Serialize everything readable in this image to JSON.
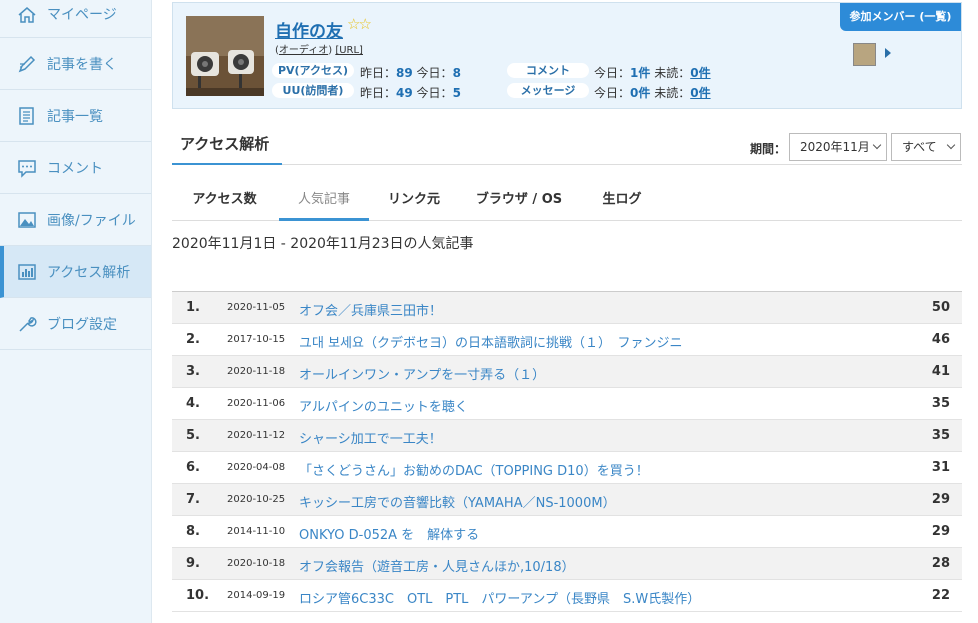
{
  "sidebar": {
    "items": [
      {
        "label": "マイページ",
        "icon": "home-icon"
      },
      {
        "label": "記事を書く",
        "icon": "pencil-icon"
      },
      {
        "label": "記事一覧",
        "icon": "document-list-icon"
      },
      {
        "label": "コメント",
        "icon": "comment-icon"
      },
      {
        "label": "画像/ファイル",
        "icon": "image-icon"
      },
      {
        "label": "アクセス解析",
        "icon": "bar-chart-icon"
      },
      {
        "label": "ブログ設定",
        "icon": "wrench-icon"
      }
    ]
  },
  "blog": {
    "title": "自作の友",
    "stars": "☆☆",
    "category_prefix": "(",
    "category": "オーディオ",
    "category_suffix": ")",
    "url_label": "[URL]",
    "pv_label": "PV(アクセス)",
    "uu_label": "UU(訪問者)",
    "comment_label": "コメント",
    "message_label": "メッセージ",
    "yesterday": "昨日：",
    "today": "今日：",
    "unread": "未読：",
    "pv_yesterday": "89",
    "pv_today": "8",
    "uu_yesterday": "49",
    "uu_today": "5",
    "comment_today": "1件",
    "comment_unread": "0件",
    "message_today": "0件",
    "message_unread": "0件",
    "member_button": "参加メンバー (一覧)"
  },
  "analytics": {
    "title": "アクセス解析",
    "period_label": "期間：",
    "period_value": "2020年11月",
    "filter_value": "すべて",
    "tabs": [
      "アクセス数",
      "人気記事",
      "リンク元",
      "ブラウザ / OS",
      "生ログ"
    ],
    "active_tab": "人気記事",
    "range_text": "2020年11月1日 - 2020年11月23日の人気記事"
  },
  "articles": [
    {
      "rank": "1.",
      "date": "2020-11-05",
      "title": "オフ会／兵庫県三田市！",
      "count": "50"
    },
    {
      "rank": "2.",
      "date": "2017-10-15",
      "title": "ユ대 보세요（クデボセヨ）の日本語歌詞に挑戦（１）　ファンジニ",
      "count": "46"
    },
    {
      "rank": "3.",
      "date": "2020-11-18",
      "title": "オールインワン・アンプを一寸弄る（１）",
      "count": "41"
    },
    {
      "rank": "4.",
      "date": "2020-11-06",
      "title": "アルパインのユニットを聴く",
      "count": "35"
    },
    {
      "rank": "5.",
      "date": "2020-11-12",
      "title": "シャーシ加工で一工夫！",
      "count": "35"
    },
    {
      "rank": "6.",
      "date": "2020-04-08",
      "title": "「さくどうさん」お勧めのDAC（TOPPING D10）を買う！",
      "count": "31"
    },
    {
      "rank": "7.",
      "date": "2020-10-25",
      "title": "キッシー工房での音響比較（YAMAHA／NS-1000M）",
      "count": "29"
    },
    {
      "rank": "8.",
      "date": "2014-11-10",
      "title": "ONKYO D-052A を　解体する",
      "count": "29"
    },
    {
      "rank": "9.",
      "date": "2020-10-18",
      "title": "オフ会報告（遊音工房・人見さんほか,10/18）",
      "count": "28"
    },
    {
      "rank": "10.",
      "date": "2014-09-19",
      "title": "ロシア管6C33C　OTL　PTL　パワーアンプ（長野県　S.W氏製作）",
      "count": "22"
    }
  ]
}
